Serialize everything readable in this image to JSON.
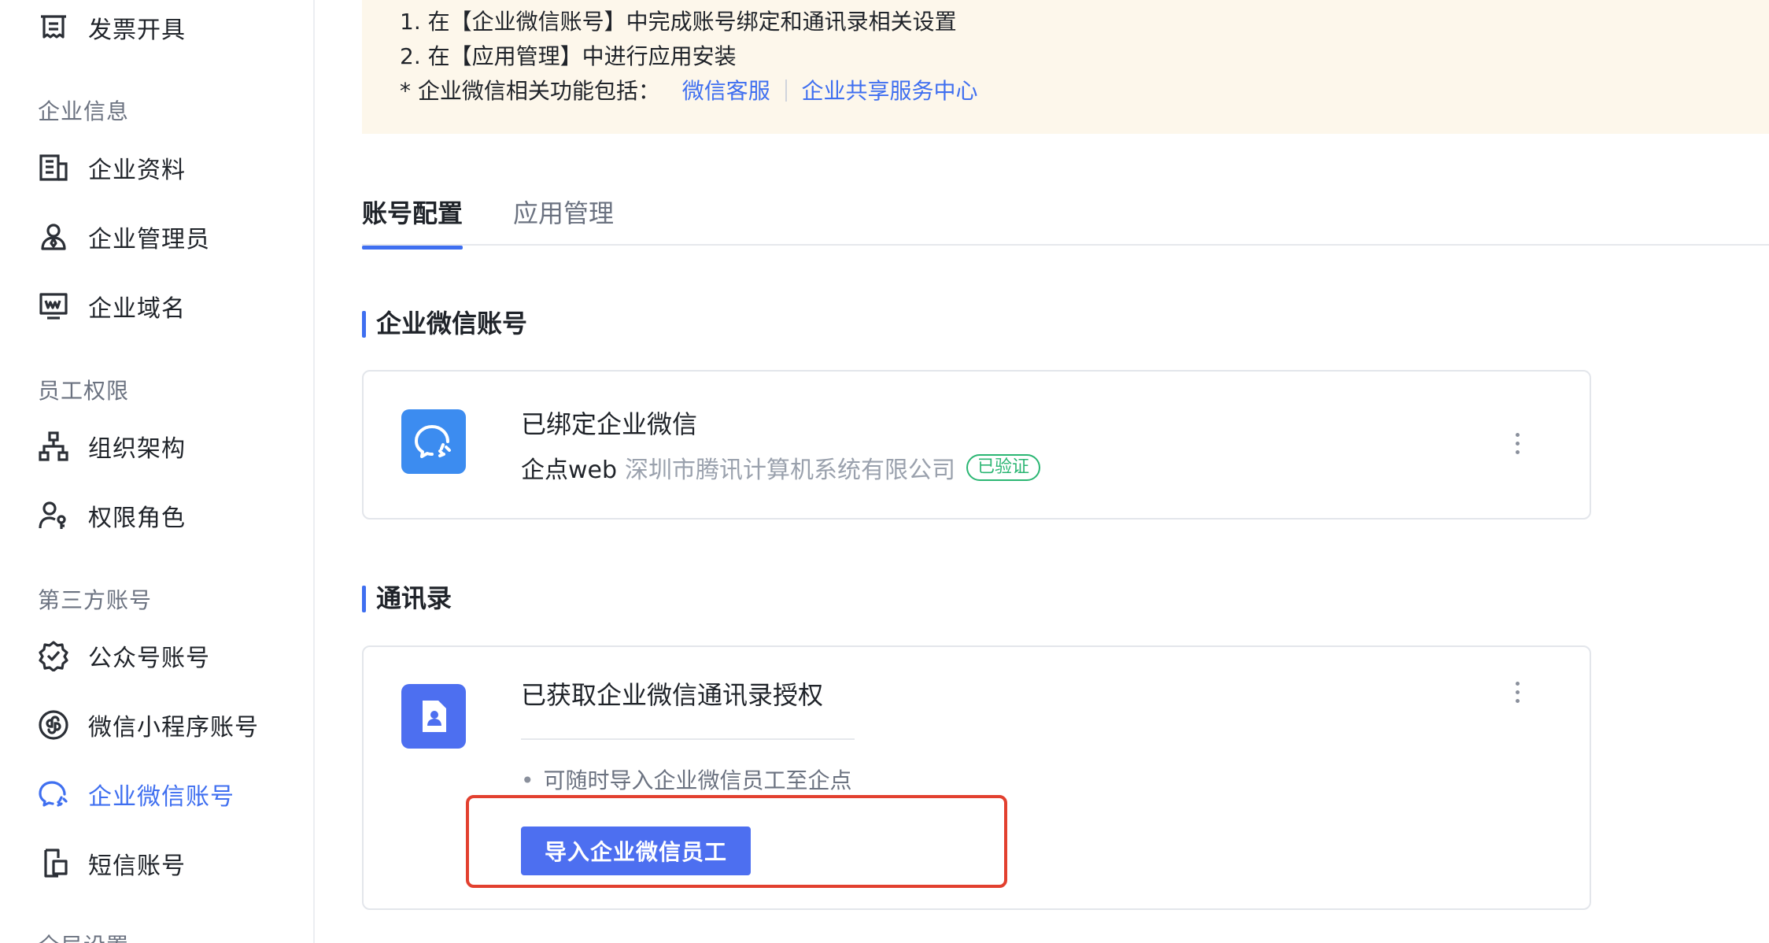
{
  "sidebar": {
    "top_item": {
      "label": "发票开具",
      "icon": "invoice-icon"
    },
    "groups": [
      {
        "title": "企业信息",
        "items": [
          {
            "label": "企业资料",
            "icon": "company-profile-icon"
          },
          {
            "label": "企业管理员",
            "icon": "admin-user-icon"
          },
          {
            "label": "企业域名",
            "icon": "domain-monitor-icon"
          }
        ]
      },
      {
        "title": "员工权限",
        "items": [
          {
            "label": "组织架构",
            "icon": "org-chart-icon"
          },
          {
            "label": "权限角色",
            "icon": "role-permission-icon"
          }
        ]
      },
      {
        "title": "第三方账号",
        "items": [
          {
            "label": "公众号账号",
            "icon": "official-account-badge-icon"
          },
          {
            "label": "微信小程序账号",
            "icon": "mini-program-icon"
          },
          {
            "label": "企业微信账号",
            "icon": "wecom-icon",
            "active": true
          },
          {
            "label": "短信账号",
            "icon": "sms-phone-icon"
          }
        ]
      },
      {
        "title": "全局设置",
        "items": []
      }
    ]
  },
  "notice": {
    "line1": "1. 在【企业微信账号】中完成账号绑定和通讯录相关设置",
    "line2": "2. 在【应用管理】中进行应用安装",
    "line3_prefix": "* 企业微信相关功能包括：",
    "links": [
      "微信客服",
      "企业共享服务中心"
    ]
  },
  "tabs": [
    {
      "label": "账号配置",
      "active": true
    },
    {
      "label": "应用管理",
      "active": false
    }
  ],
  "wecom_section": {
    "title": "企业微信账号",
    "card": {
      "logo_icon": "wecom-chat-icon",
      "title": "已绑定企业微信",
      "corp_short": "企点web",
      "corp_full": "深圳市腾讯计算机系统有限公司",
      "badge": "已验证"
    }
  },
  "contacts_section": {
    "title": "通讯录",
    "card": {
      "logo_icon": "contact-file-icon",
      "title": "已获取企业微信通讯录授权",
      "bullet": "可随时导入企业微信员工至企点",
      "button": "导入企业微信员工"
    }
  },
  "colors": {
    "accent": "#3f6ff0",
    "notice_bg": "#fdf7eb",
    "verified_green": "#2bb673",
    "highlight_red": "#e2402f",
    "wecom_logo_bg": "#3c8cf0",
    "contacts_logo_bg": "#4d6ff0"
  }
}
